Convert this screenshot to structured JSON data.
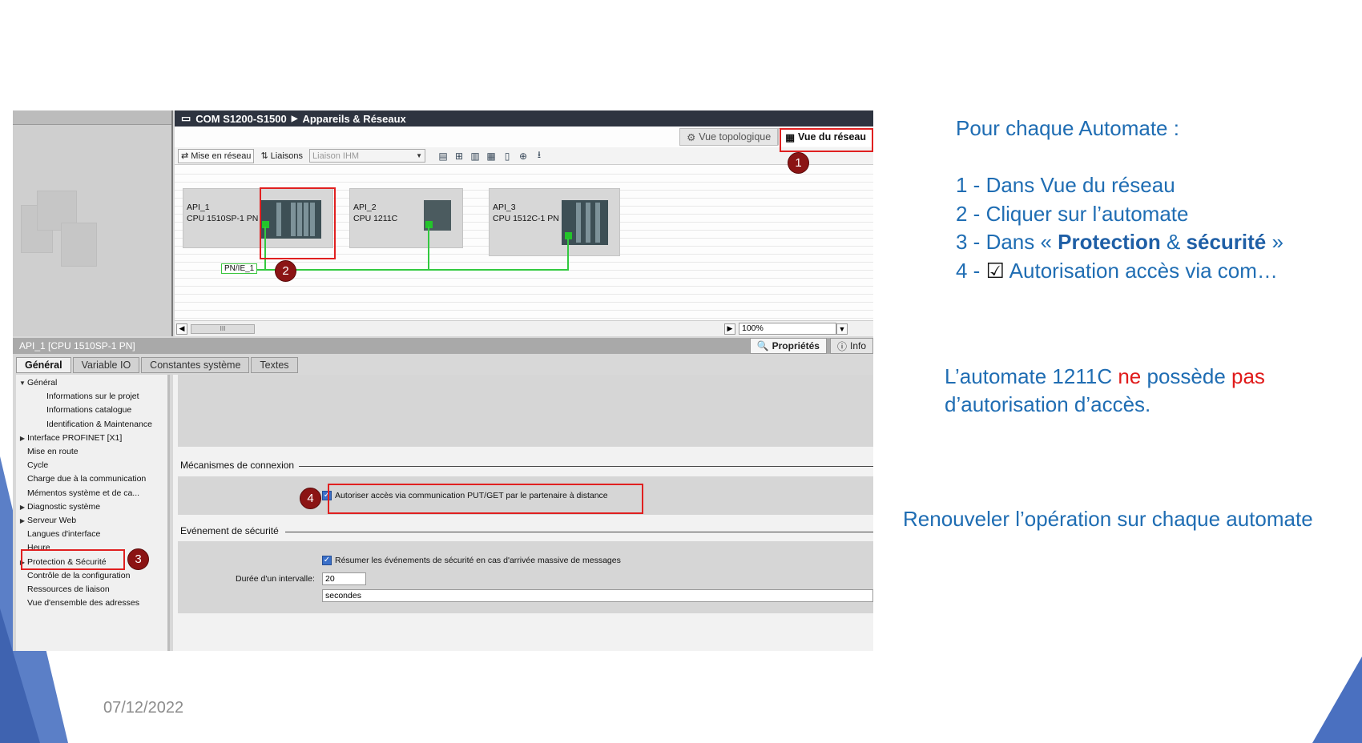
{
  "date": "07/12/2022",
  "tia": {
    "breadcrumb": [
      "COM S1200-S1500",
      "Appareils & Réseaux"
    ],
    "view_tabs": [
      "Vue topologique",
      "Vue du réseau"
    ],
    "toolbar": {
      "network_button": "Mise en réseau",
      "connections_button": "Liaisons",
      "connection_select": "Liaison IHM"
    },
    "devices": [
      {
        "name": "API_1",
        "cpu": "CPU 1510SP-1 PN"
      },
      {
        "name": "API_2",
        "cpu": "CPU 1211C"
      },
      {
        "name": "API_3",
        "cpu": "CPU 1512C-1 PN"
      }
    ],
    "network_label": "PN/IE_1",
    "zoom": "100%",
    "scroll_thumb": "III",
    "inspector": {
      "title": "API_1 [CPU 1510SP-1 PN]",
      "right_tabs": [
        "Propriétés",
        "Info"
      ],
      "tabs": [
        "Général",
        "Variable IO",
        "Constantes système",
        "Textes"
      ],
      "nav": [
        {
          "label": "Général",
          "arrow": "▼",
          "indent": 0
        },
        {
          "label": "Informations sur le projet",
          "arrow": "",
          "indent": 1
        },
        {
          "label": "Informations catalogue",
          "arrow": "",
          "indent": 1
        },
        {
          "label": "Identification & Maintenance",
          "arrow": "",
          "indent": 1
        },
        {
          "label": "Interface PROFINET [X1]",
          "arrow": "▶",
          "indent": 0
        },
        {
          "label": "Mise en route",
          "arrow": "",
          "indent": 0
        },
        {
          "label": "Cycle",
          "arrow": "",
          "indent": 0
        },
        {
          "label": "Charge due à la communication",
          "arrow": "",
          "indent": 0
        },
        {
          "label": "Mémentos système et de ca...",
          "arrow": "",
          "indent": 0
        },
        {
          "label": "Diagnostic système",
          "arrow": "▶",
          "indent": 0
        },
        {
          "label": "Serveur Web",
          "arrow": "▶",
          "indent": 0
        },
        {
          "label": "Langues d'interface",
          "arrow": "",
          "indent": 0
        },
        {
          "label": "Heure",
          "arrow": "",
          "indent": 0
        },
        {
          "label": "Protection & Sécurité",
          "arrow": "▶",
          "indent": 0
        },
        {
          "label": "Contrôle de la configuration",
          "arrow": "",
          "indent": 0
        },
        {
          "label": "Ressources de liaison",
          "arrow": "",
          "indent": 0
        },
        {
          "label": "Vue d'ensemble des adresses",
          "arrow": "",
          "indent": 0
        }
      ],
      "section_connection": "Mécanismes de connexion",
      "checkbox_putget": "Autoriser accès via communication PUT/GET par le partenaire à distance",
      "section_security": "Evénement de sécurité",
      "checkbox_summarize": "Résumer les événements de sécurité en cas d'arrivée massive de messages",
      "interval_label": "Durée d'un intervalle:",
      "interval_value": "20",
      "interval_unit": "secondes"
    },
    "markers": [
      "1",
      "2",
      "3",
      "4"
    ]
  },
  "instructions": {
    "heading": "Pour chaque Automate :",
    "step1": "1 - Dans Vue du réseau",
    "step2": "2 - Cliquer sur l’automate",
    "step3_prefix": "3 - Dans « ",
    "step3_bold1": "Protection",
    "step3_mid": " & ",
    "step3_bold2": "sécurité",
    "step3_suffix": " »",
    "step4_prefix": "4 - ",
    "step4_check": "☑",
    "step4_text": " Autorisation accès via com…",
    "note_a": "L’automate 1211C ",
    "note_ne": "ne",
    "note_b": " possède ",
    "note_pas": "pas",
    "note_line2": "d’autorisation d’accès.",
    "renew": "Renouveler l’opération sur chaque automate"
  }
}
